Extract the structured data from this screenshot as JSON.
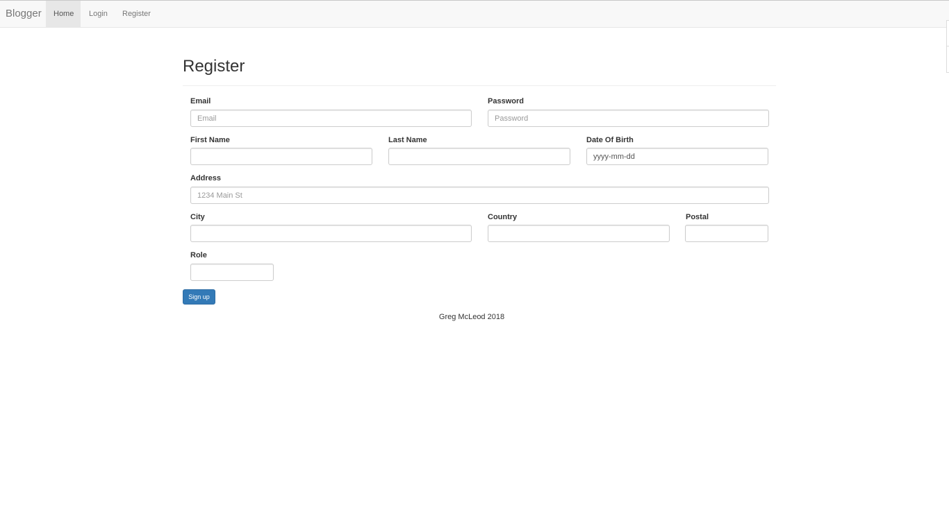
{
  "nav": {
    "brand": "Blogger",
    "links": [
      {
        "label": "Home"
      },
      {
        "label": "Login"
      },
      {
        "label": "Register"
      }
    ]
  },
  "page": {
    "title": "Register"
  },
  "form": {
    "email": {
      "label": "Email",
      "placeholder": "Email",
      "value": ""
    },
    "password": {
      "label": "Password",
      "placeholder": "Password",
      "value": ""
    },
    "first_name": {
      "label": "First Name",
      "placeholder": "",
      "value": ""
    },
    "last_name": {
      "label": "Last Name",
      "placeholder": "",
      "value": ""
    },
    "dob": {
      "label": "Date Of Birth",
      "placeholder": "",
      "value": "yyyy-mm-dd"
    },
    "address": {
      "label": "Address",
      "placeholder": "1234 Main St",
      "value": ""
    },
    "city": {
      "label": "City",
      "placeholder": "",
      "value": ""
    },
    "country": {
      "label": "Country",
      "placeholder": "",
      "value": ""
    },
    "postal": {
      "label": "Postal",
      "placeholder": "",
      "value": ""
    },
    "role": {
      "label": "Role",
      "placeholder": "",
      "value": ""
    },
    "submit_label": "Sign up"
  },
  "footer": {
    "text": "Greg McLeod 2018"
  },
  "colors": {
    "primary": "#337ab7",
    "navbar_bg": "#f8f8f8",
    "active_nav_bg": "#e7e7e7"
  }
}
